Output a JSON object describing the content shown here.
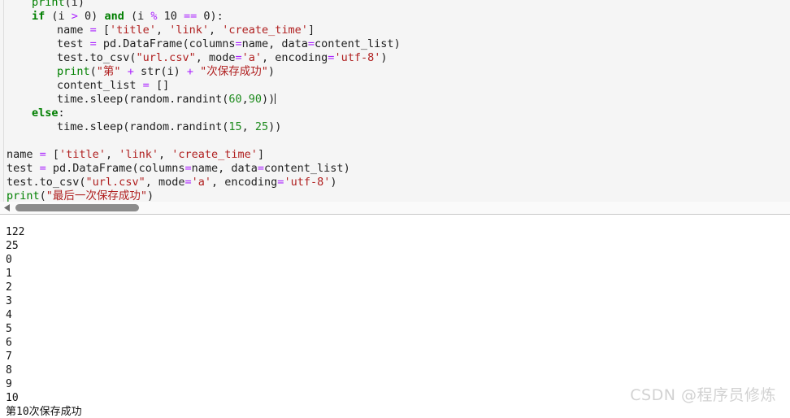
{
  "editor": {
    "language": "python",
    "background": "#f5f5f5",
    "colors": {
      "keyword": "#007f00",
      "builtin": "#008000",
      "operator": "#aa22ff",
      "string": "#b02020",
      "number": "#1e8b1e",
      "plain": "#202020"
    },
    "lines": [
      {
        "indent": 1,
        "clipped": true,
        "tokens": [
          {
            "t": "print",
            "c": "bi"
          },
          {
            "t": "(i)",
            "c": "pl"
          }
        ]
      },
      {
        "indent": 1,
        "tokens": [
          {
            "t": "if",
            "c": "kw"
          },
          {
            "t": " (i ",
            "c": "pl"
          },
          {
            "t": ">",
            "c": "op"
          },
          {
            "t": " 0) ",
            "c": "pl"
          },
          {
            "t": "and",
            "c": "kw"
          },
          {
            "t": " (i ",
            "c": "pl"
          },
          {
            "t": "%",
            "c": "op"
          },
          {
            "t": " 10 ",
            "c": "pl"
          },
          {
            "t": "==",
            "c": "op"
          },
          {
            "t": " 0):",
            "c": "pl"
          }
        ]
      },
      {
        "indent": 2,
        "tokens": [
          {
            "t": "name ",
            "c": "pl"
          },
          {
            "t": "=",
            "c": "op"
          },
          {
            "t": " [",
            "c": "pl"
          },
          {
            "t": "'title'",
            "c": "str"
          },
          {
            "t": ", ",
            "c": "pl"
          },
          {
            "t": "'link'",
            "c": "str"
          },
          {
            "t": ", ",
            "c": "pl"
          },
          {
            "t": "'create_time'",
            "c": "str"
          },
          {
            "t": "]",
            "c": "pl"
          }
        ]
      },
      {
        "indent": 2,
        "tokens": [
          {
            "t": "test ",
            "c": "pl"
          },
          {
            "t": "=",
            "c": "op"
          },
          {
            "t": " pd.DataFrame(columns",
            "c": "pl"
          },
          {
            "t": "=",
            "c": "op"
          },
          {
            "t": "name, data",
            "c": "pl"
          },
          {
            "t": "=",
            "c": "op"
          },
          {
            "t": "content_list)",
            "c": "pl"
          }
        ]
      },
      {
        "indent": 2,
        "tokens": [
          {
            "t": "test.to_csv(",
            "c": "pl"
          },
          {
            "t": "\"url.csv\"",
            "c": "str"
          },
          {
            "t": ", mode",
            "c": "pl"
          },
          {
            "t": "=",
            "c": "op"
          },
          {
            "t": "'a'",
            "c": "str"
          },
          {
            "t": ", encoding",
            "c": "pl"
          },
          {
            "t": "=",
            "c": "op"
          },
          {
            "t": "'utf-8'",
            "c": "str"
          },
          {
            "t": ")",
            "c": "pl"
          }
        ]
      },
      {
        "indent": 2,
        "tokens": [
          {
            "t": "print",
            "c": "bi"
          },
          {
            "t": "(",
            "c": "pl"
          },
          {
            "t": "\"第\"",
            "c": "str"
          },
          {
            "t": " ",
            "c": "pl"
          },
          {
            "t": "+",
            "c": "op"
          },
          {
            "t": " str(i) ",
            "c": "pl"
          },
          {
            "t": "+",
            "c": "op"
          },
          {
            "t": " ",
            "c": "pl"
          },
          {
            "t": "\"次保存成功\"",
            "c": "str"
          },
          {
            "t": ")",
            "c": "pl"
          }
        ]
      },
      {
        "indent": 2,
        "tokens": [
          {
            "t": "content_list ",
            "c": "pl"
          },
          {
            "t": "=",
            "c": "op"
          },
          {
            "t": " []",
            "c": "pl"
          }
        ]
      },
      {
        "indent": 2,
        "caret": true,
        "tokens": [
          {
            "t": "time.sleep(random.randint(",
            "c": "pl"
          },
          {
            "t": "60",
            "c": "num"
          },
          {
            "t": ",",
            "c": "pl"
          },
          {
            "t": "90",
            "c": "num"
          },
          {
            "t": "))",
            "c": "pl"
          }
        ]
      },
      {
        "indent": 1,
        "tokens": [
          {
            "t": "else",
            "c": "kw"
          },
          {
            "t": ":",
            "c": "pl"
          }
        ]
      },
      {
        "indent": 2,
        "tokens": [
          {
            "t": "time.sleep(random.randint(",
            "c": "pl"
          },
          {
            "t": "15",
            "c": "num"
          },
          {
            "t": ", ",
            "c": "pl"
          },
          {
            "t": "25",
            "c": "num"
          },
          {
            "t": "))",
            "c": "pl"
          }
        ]
      },
      {
        "indent": 0,
        "blank": true,
        "tokens": []
      },
      {
        "indent": 0,
        "tokens": [
          {
            "t": "name ",
            "c": "pl"
          },
          {
            "t": "=",
            "c": "op"
          },
          {
            "t": " [",
            "c": "pl"
          },
          {
            "t": "'title'",
            "c": "str"
          },
          {
            "t": ", ",
            "c": "pl"
          },
          {
            "t": "'link'",
            "c": "str"
          },
          {
            "t": ", ",
            "c": "pl"
          },
          {
            "t": "'create_time'",
            "c": "str"
          },
          {
            "t": "]",
            "c": "pl"
          }
        ]
      },
      {
        "indent": 0,
        "tokens": [
          {
            "t": "test ",
            "c": "pl"
          },
          {
            "t": "=",
            "c": "op"
          },
          {
            "t": " pd.DataFrame(columns",
            "c": "pl"
          },
          {
            "t": "=",
            "c": "op"
          },
          {
            "t": "name, data",
            "c": "pl"
          },
          {
            "t": "=",
            "c": "op"
          },
          {
            "t": "content_list)",
            "c": "pl"
          }
        ]
      },
      {
        "indent": 0,
        "tokens": [
          {
            "t": "test.to_csv(",
            "c": "pl"
          },
          {
            "t": "\"url.csv\"",
            "c": "str"
          },
          {
            "t": ", mode",
            "c": "pl"
          },
          {
            "t": "=",
            "c": "op"
          },
          {
            "t": "'a'",
            "c": "str"
          },
          {
            "t": ", encoding",
            "c": "pl"
          },
          {
            "t": "=",
            "c": "op"
          },
          {
            "t": "'utf-8'",
            "c": "str"
          },
          {
            "t": ")",
            "c": "pl"
          }
        ]
      },
      {
        "indent": 0,
        "tokens": [
          {
            "t": "print",
            "c": "bi"
          },
          {
            "t": "(",
            "c": "pl"
          },
          {
            "t": "\"最后一次保存成功\"",
            "c": "str"
          },
          {
            "t": ")",
            "c": "pl"
          }
        ]
      }
    ]
  },
  "scrollbar": {
    "orientation": "horizontal",
    "left_arrow_icon": "caret-left-icon",
    "thumb_color": "#8c8c8c",
    "track_color": "#fafafa"
  },
  "console": {
    "background": "#ffffff",
    "lines": [
      "122",
      "25",
      "0",
      "1",
      "2",
      "3",
      "4",
      "5",
      "6",
      "7",
      "8",
      "9",
      "10",
      "第10次保存成功"
    ]
  },
  "watermark": {
    "text": "CSDN @程序员修炼",
    "color": "#d2d2d2"
  }
}
